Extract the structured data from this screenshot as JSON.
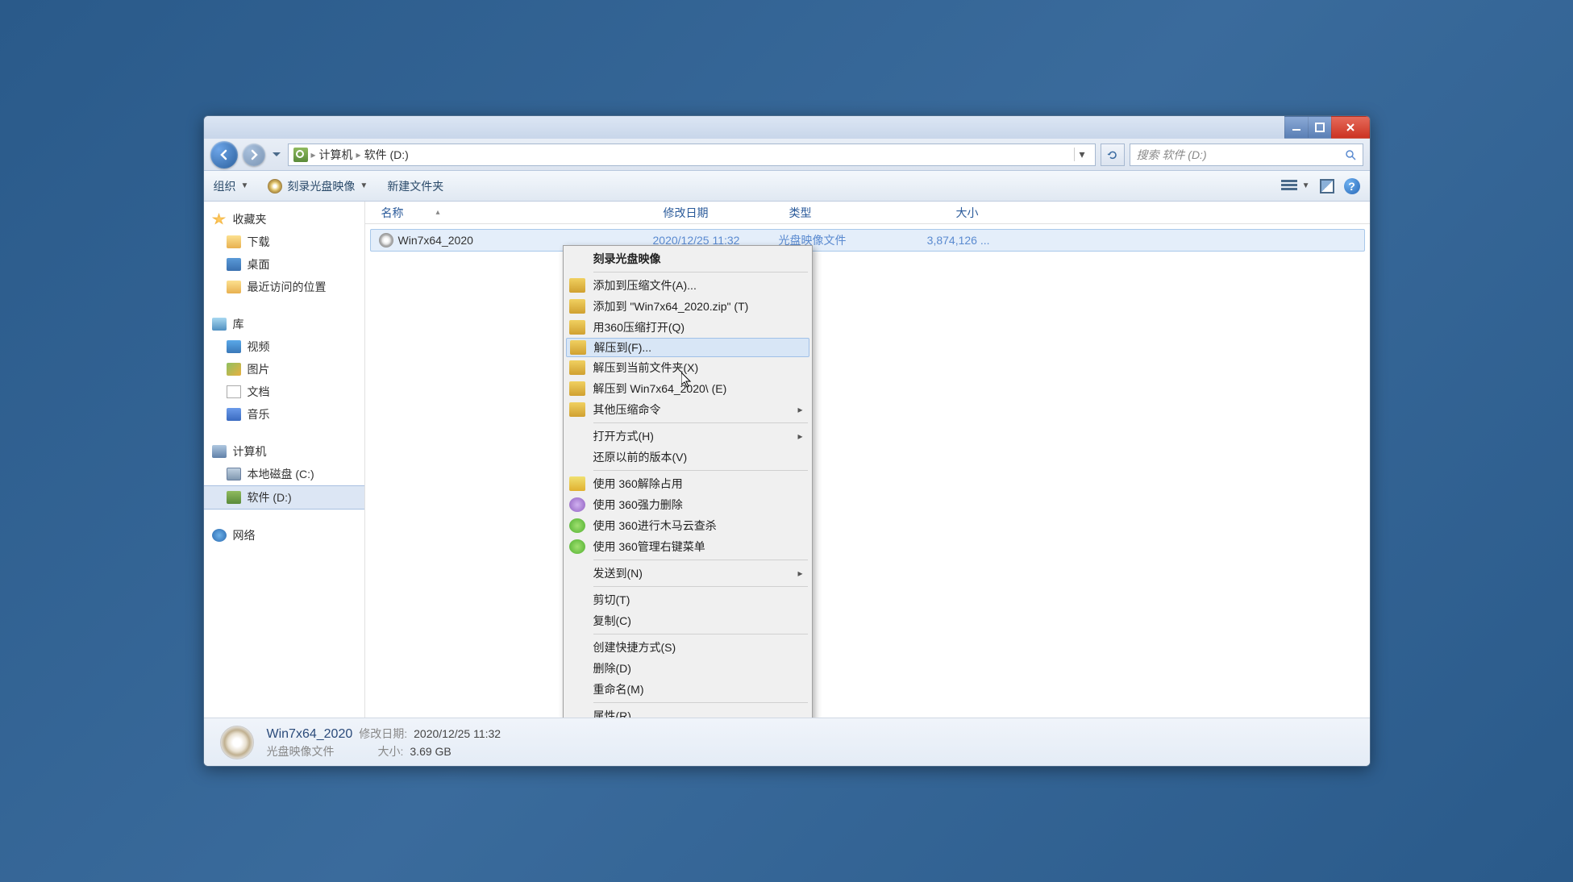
{
  "window": {
    "breadcrumb": {
      "root": "计算机",
      "sep": "▸",
      "current": "软件 (D:)"
    },
    "search_placeholder": "搜索 软件 (D:)"
  },
  "toolbar": {
    "organize": "组织",
    "burn": "刻录光盘映像",
    "new_folder": "新建文件夹"
  },
  "sidebar": {
    "favorites": {
      "heading": "收藏夹",
      "items": [
        "下载",
        "桌面",
        "最近访问的位置"
      ]
    },
    "libraries": {
      "heading": "库",
      "items": [
        "视频",
        "图片",
        "文档",
        "音乐"
      ]
    },
    "computer": {
      "heading": "计算机",
      "items": [
        "本地磁盘 (C:)",
        "软件 (D:)"
      ]
    },
    "network": {
      "heading": "网络"
    }
  },
  "columns": {
    "name": "名称",
    "date": "修改日期",
    "type": "类型",
    "size": "大小"
  },
  "files": [
    {
      "name": "Win7x64_2020",
      "date": "2020/12/25 11:32",
      "type": "光盘映像文件",
      "size": "3,874,126 ..."
    }
  ],
  "context_menu": {
    "burn": "刻录光盘映像",
    "add_archive": "添加到压缩文件(A)...",
    "add_zip": "添加到 \"Win7x64_2020.zip\" (T)",
    "open_360zip": "用360压缩打开(Q)",
    "extract_to": "解压到(F)...",
    "extract_here": "解压到当前文件夹(X)",
    "extract_named": "解压到 Win7x64_2020\\ (E)",
    "other_zip": "其他压缩命令",
    "open_with": "打开方式(H)",
    "restore_prev": "还原以前的版本(V)",
    "s360_unlock": "使用 360解除占用",
    "s360_force_del": "使用 360强力删除",
    "s360_trojan": "使用 360进行木马云查杀",
    "s360_menu": "使用 360管理右键菜单",
    "send_to": "发送到(N)",
    "cut": "剪切(T)",
    "copy": "复制(C)",
    "shortcut": "创建快捷方式(S)",
    "delete": "删除(D)",
    "rename": "重命名(M)",
    "properties": "属性(R)"
  },
  "statusbar": {
    "name": "Win7x64_2020",
    "type": "光盘映像文件",
    "date_key": "修改日期:",
    "date_val": "2020/12/25 11:32",
    "size_key": "大小:",
    "size_val": "3.69 GB"
  }
}
